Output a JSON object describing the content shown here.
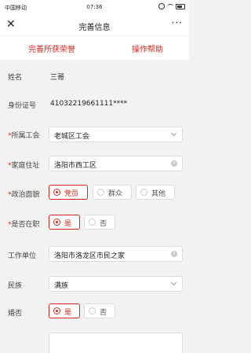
{
  "status_bar": {
    "carrier": "中国移动",
    "time": "07:36"
  },
  "nav": {
    "close_glyph": "✕",
    "title": "完善信息",
    "more_glyph": "···"
  },
  "actions": {
    "left": "完善所获荣誉",
    "right": "操作帮助"
  },
  "form": {
    "name": {
      "label": "姓名",
      "value": "三哥"
    },
    "id_number": {
      "label": "身份证号",
      "value": "41032219661111****"
    },
    "union": {
      "required": "*",
      "label": "所属工会",
      "value": "老城区工会"
    },
    "address": {
      "required": "*",
      "label": "家庭住址",
      "value": "洛阳市西工区"
    },
    "political": {
      "required": "*",
      "label": "政治面貌",
      "options": [
        "党员",
        "群众",
        "其他"
      ],
      "selected": "党员"
    },
    "employed": {
      "required": "*",
      "label": "是否在职",
      "options": [
        "是",
        "否"
      ],
      "selected": "是"
    },
    "workplace": {
      "label": "工作单位",
      "value": "洛阳市洛龙区市民之家"
    },
    "ethnicity": {
      "label": "民族",
      "value": "满族"
    },
    "married": {
      "label": "婚否",
      "options": [
        "是",
        "否"
      ],
      "selected": "是"
    }
  },
  "colors": {
    "accent": "#d7281e",
    "background": "#f2f2f2"
  }
}
